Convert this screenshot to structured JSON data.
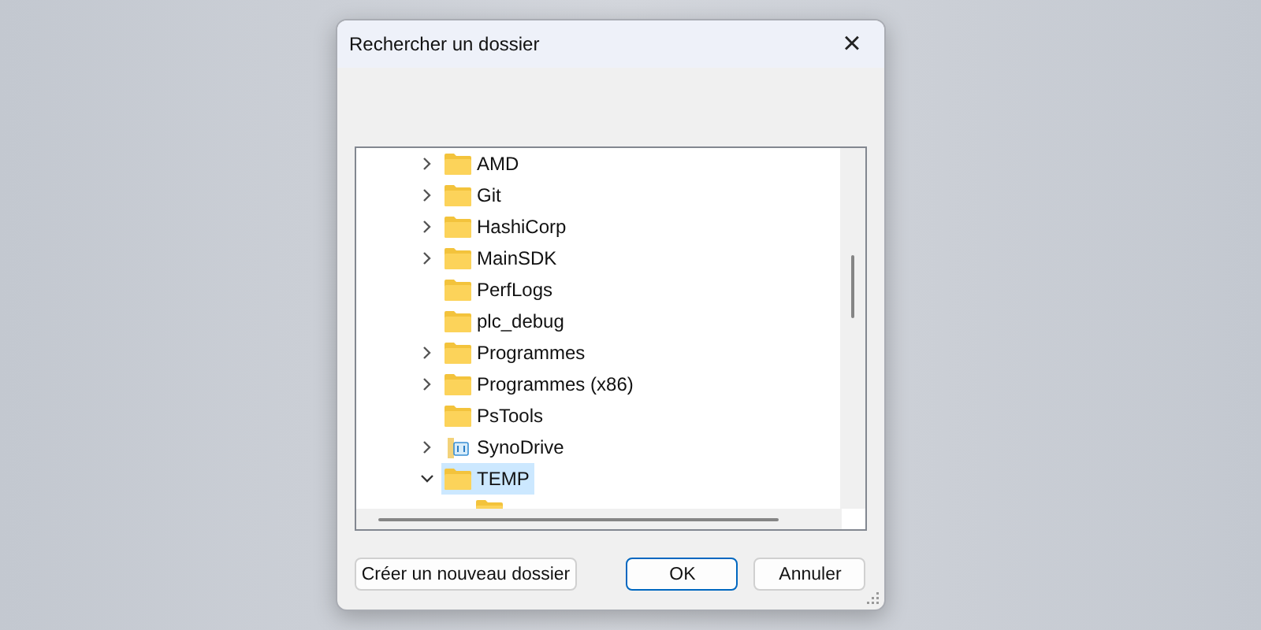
{
  "window": {
    "title": "Rechercher un dossier",
    "close": "×"
  },
  "tree": {
    "items": [
      {
        "name": "AMD",
        "kind": "folder",
        "expandable": true,
        "expanded": false,
        "selected": false
      },
      {
        "name": "Git",
        "kind": "folder",
        "expandable": true,
        "expanded": false,
        "selected": false
      },
      {
        "name": "HashiCorp",
        "kind": "folder",
        "expandable": true,
        "expanded": false,
        "selected": false
      },
      {
        "name": "MainSDK",
        "kind": "folder",
        "expandable": true,
        "expanded": false,
        "selected": false
      },
      {
        "name": "PerfLogs",
        "kind": "folder",
        "expandable": false,
        "selected": false
      },
      {
        "name": "plc_debug",
        "kind": "folder",
        "expandable": false,
        "selected": false
      },
      {
        "name": "Programmes",
        "kind": "folder",
        "expandable": true,
        "expanded": false,
        "selected": false
      },
      {
        "name": "Programmes (x86)",
        "kind": "folder",
        "expandable": true,
        "expanded": false,
        "selected": false
      },
      {
        "name": "PsTools",
        "kind": "folder",
        "expandable": false,
        "selected": false
      },
      {
        "name": "SynoDrive",
        "kind": "sync-folder",
        "expandable": true,
        "expanded": false,
        "selected": false
      },
      {
        "name": "TEMP",
        "kind": "folder",
        "expandable": true,
        "expanded": true,
        "selected": true,
        "children": [
          {
            "kind": "folder"
          }
        ]
      }
    ]
  },
  "buttons": [
    {
      "label": "Créer un nouveau dossier",
      "kind": "secondary"
    },
    {
      "label": "OK",
      "kind": "default"
    },
    {
      "label": "Annuler",
      "kind": "secondary"
    }
  ]
}
